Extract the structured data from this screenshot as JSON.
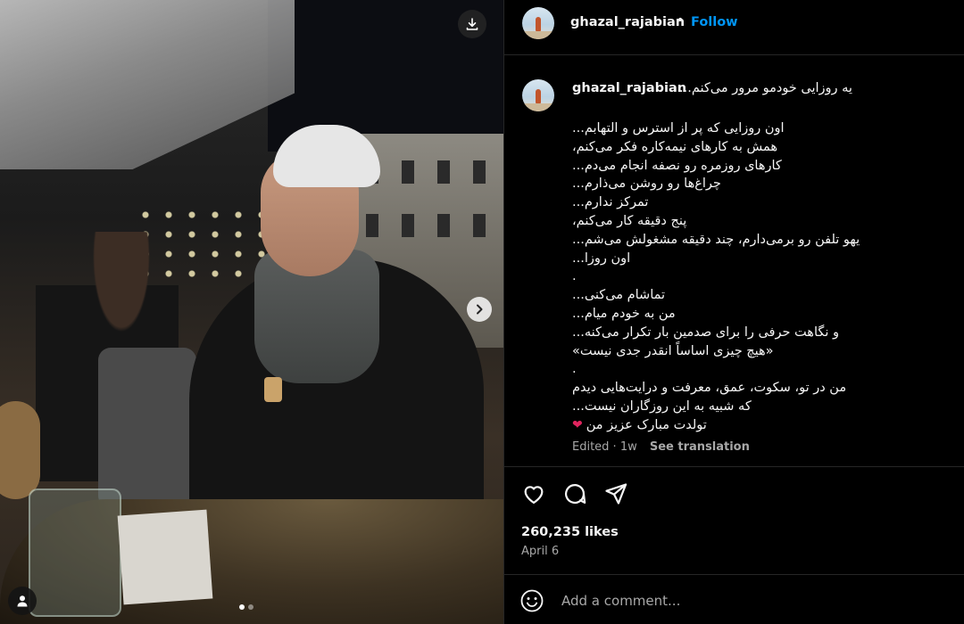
{
  "post": {
    "username": "ghazal_rajabian",
    "follow_label": "Follow",
    "separator": "•"
  },
  "caption": {
    "first_line": "یه روزایی خودمو مرور می‌کنم...",
    "lines": [
      "اون روزایی که پر از استرس و التهابم...",
      "همش به کارهای نیمه‌کاره فکر می‌کنم،",
      "کارهای روزمره رو نصفه انجام می‌دم...",
      "چراغ‌ها رو روشن می‌ذارم...",
      "تمرکز ندارم...",
      "پنج دقیقه کار می‌کنم،",
      "یهو تلفن رو برمی‌دارم، چند دقیقه مشغولش می‌شم...",
      "اون روزا...",
      ".",
      "تماشام می‌کنی...",
      "من به خودم میام...",
      "و نگاهت حرفی را برای صدمین بار تکرار می‌کنه...",
      "«هیچ چیزی اساساً انقدر جدی نیست»",
      ".",
      "من در تو، سکوت، عمق، معرفت و درایت‌هایی دیدم",
      "که شبیه به این روزگاران نیست...",
      "تولدت مبارک عزیز من"
    ],
    "last_emoji": "❤",
    "edited": "Edited · 1w",
    "see_translation": "See translation"
  },
  "engagement": {
    "likes": "260,235 likes",
    "date": "April 6"
  },
  "comment": {
    "placeholder": "Add a comment..."
  },
  "carousel": {
    "slides": 2,
    "active": 1
  },
  "colors": {
    "background": "#000000",
    "link": "#0095f6",
    "muted": "#a8a8a8",
    "divider": "#262626",
    "heart": "#e0245e"
  },
  "icons": {
    "download": "download-icon",
    "next": "chevron-right-icon",
    "user": "user-icon",
    "like": "heart-icon",
    "comment": "comment-icon",
    "share": "share-icon",
    "emoji": "emoji-icon"
  }
}
